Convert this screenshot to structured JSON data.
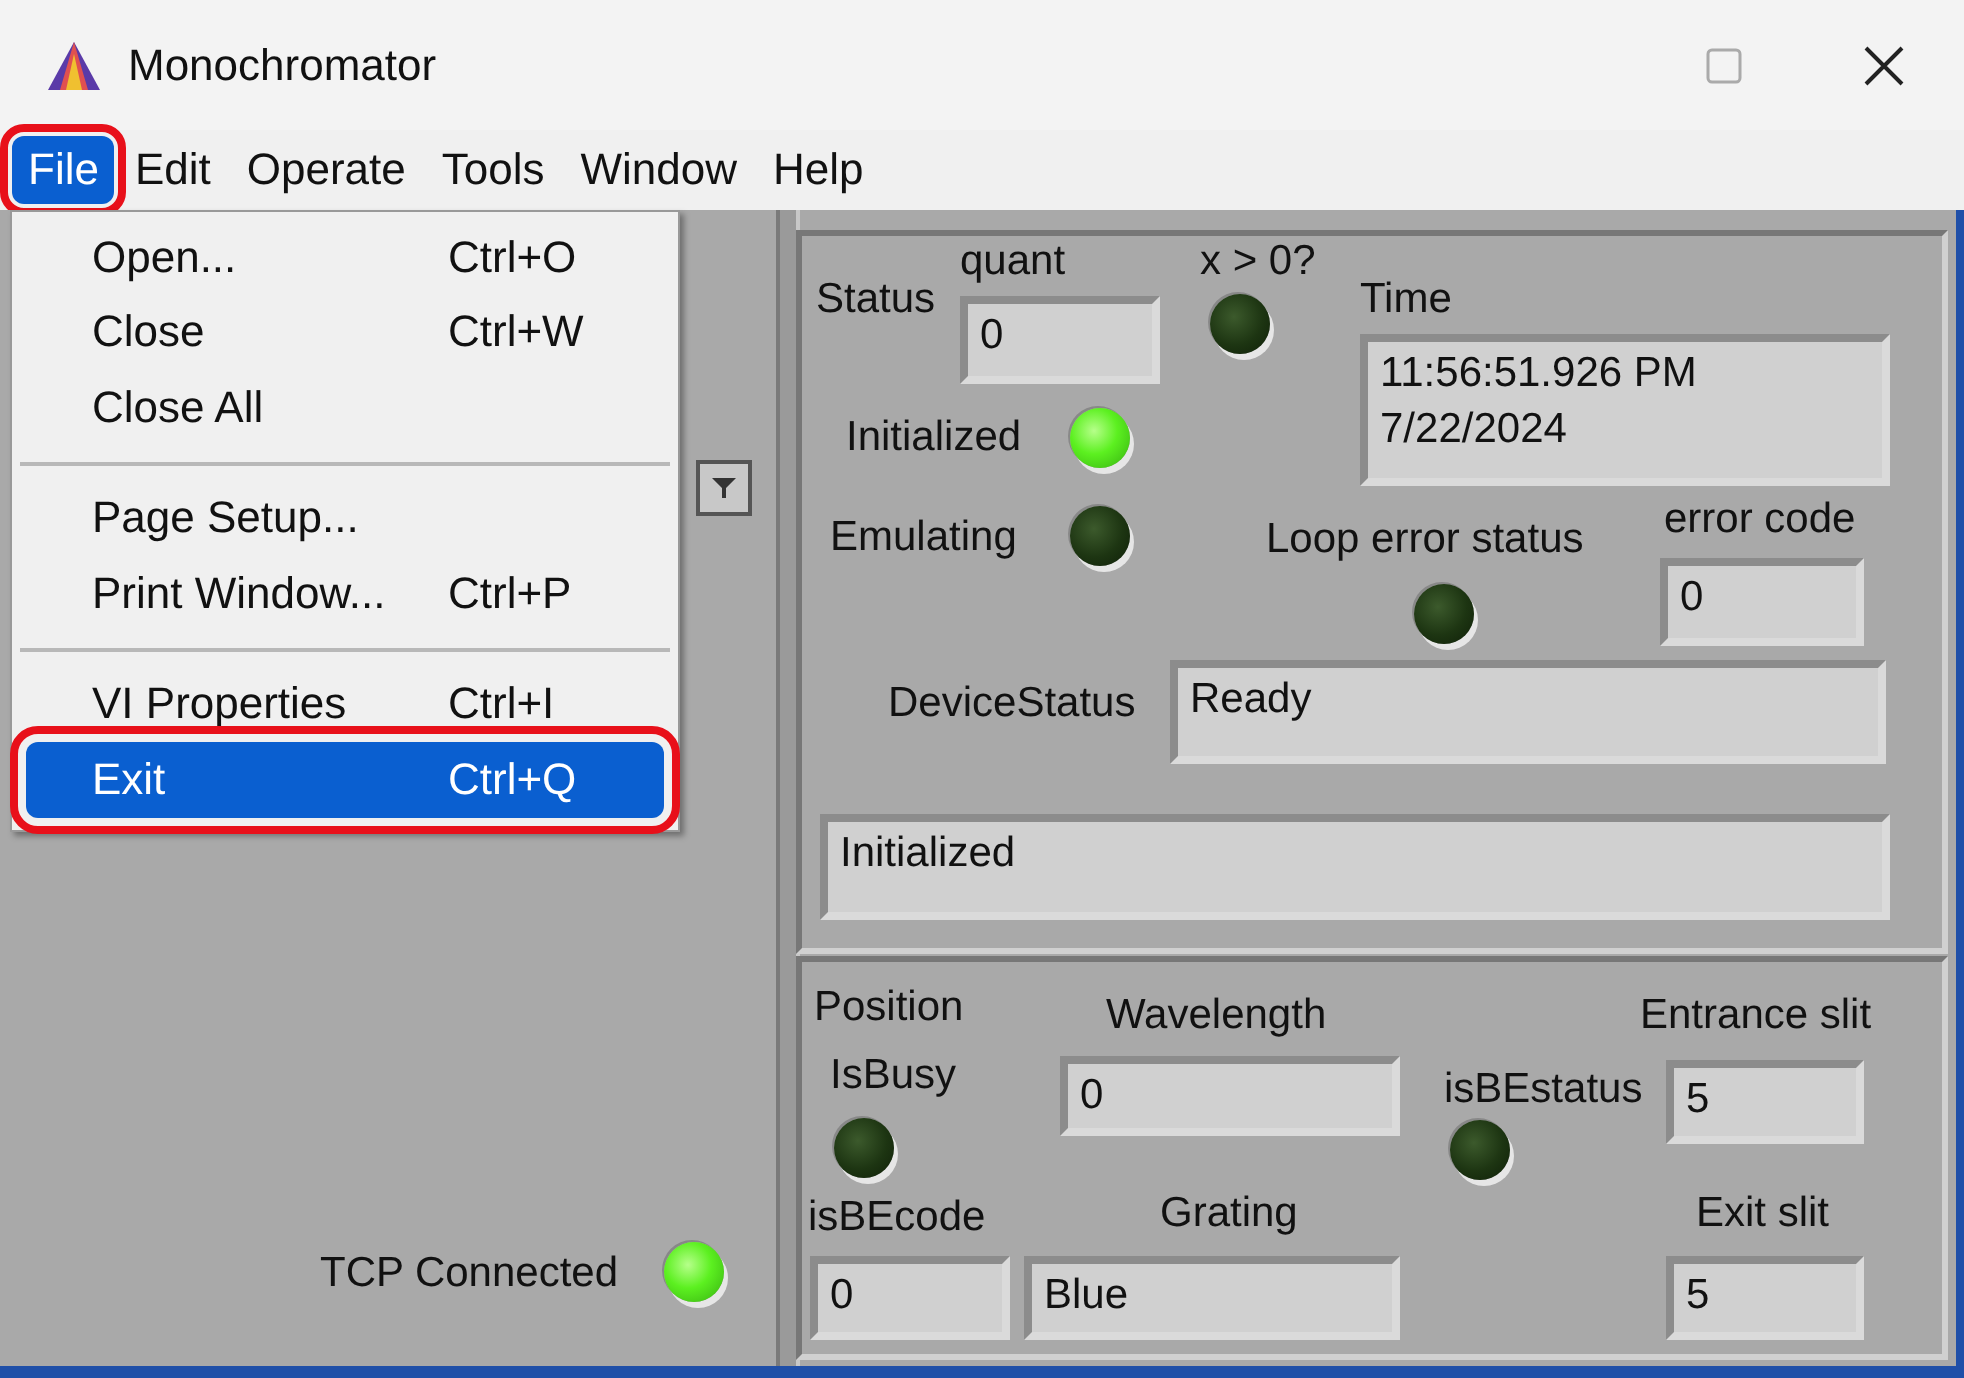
{
  "window": {
    "title": "Monochromator"
  },
  "menubar": [
    {
      "label": "File",
      "selected": true,
      "highlighted": true
    },
    {
      "label": "Edit",
      "selected": false,
      "highlighted": false
    },
    {
      "label": "Operate",
      "selected": false,
      "highlighted": false
    },
    {
      "label": "Tools",
      "selected": false,
      "highlighted": false
    },
    {
      "label": "Window",
      "selected": false,
      "highlighted": false
    },
    {
      "label": "Help",
      "selected": false,
      "highlighted": false
    }
  ],
  "file_menu": [
    {
      "kind": "item",
      "label": "Open...",
      "shortcut": "Ctrl+O",
      "selected": false,
      "highlighted": false
    },
    {
      "kind": "item",
      "label": "Close",
      "shortcut": "Ctrl+W",
      "selected": false,
      "highlighted": false
    },
    {
      "kind": "item",
      "label": "Close All",
      "selected": false,
      "highlighted": false
    },
    {
      "kind": "separator"
    },
    {
      "kind": "item",
      "label": "Page Setup...",
      "selected": false,
      "highlighted": false
    },
    {
      "kind": "item",
      "label": "Print Window...",
      "shortcut": "Ctrl+P",
      "selected": false,
      "highlighted": false
    },
    {
      "kind": "separator"
    },
    {
      "kind": "item",
      "label": "VI Properties",
      "shortcut": "Ctrl+I",
      "selected": false,
      "highlighted": false
    },
    {
      "kind": "item",
      "label": "Exit",
      "shortcut": "Ctrl+Q",
      "selected": true,
      "highlighted": true
    }
  ],
  "left_panel": {
    "tcp_connected": {
      "label": "TCP Connected",
      "on": true
    }
  },
  "status_panel": {
    "title": "Status",
    "quant": {
      "label": "quant",
      "value": "0"
    },
    "x_positive": {
      "label": "x > 0?",
      "on": false
    },
    "time": {
      "label": "Time",
      "lines": [
        "11:56:51.926 PM",
        "7/22/2024"
      ]
    },
    "initialized": {
      "label": "Initialized",
      "on": true
    },
    "emulating": {
      "label": "Emulating",
      "on": false
    },
    "loop_error_status": {
      "label": "Loop error status",
      "on": false
    },
    "error_code": {
      "label": "error code",
      "value": "0"
    },
    "device_status": {
      "label": "DeviceStatus",
      "value": "Ready"
    },
    "message": {
      "value": "Initialized"
    }
  },
  "position_panel": {
    "title": "Position",
    "is_busy": {
      "label": "IsBusy",
      "on": false
    },
    "wavelength": {
      "label": "Wavelength",
      "value": "0"
    },
    "is_be_status": {
      "label": "isBEstatus",
      "on": false
    },
    "entrance_slit": {
      "label": "Entrance slit",
      "value": "5"
    },
    "is_be_code": {
      "label": "isBEcode",
      "value": "0"
    },
    "grating": {
      "label": "Grating",
      "value": "Blue"
    },
    "exit_slit": {
      "label": "Exit slit",
      "value": "5"
    }
  }
}
